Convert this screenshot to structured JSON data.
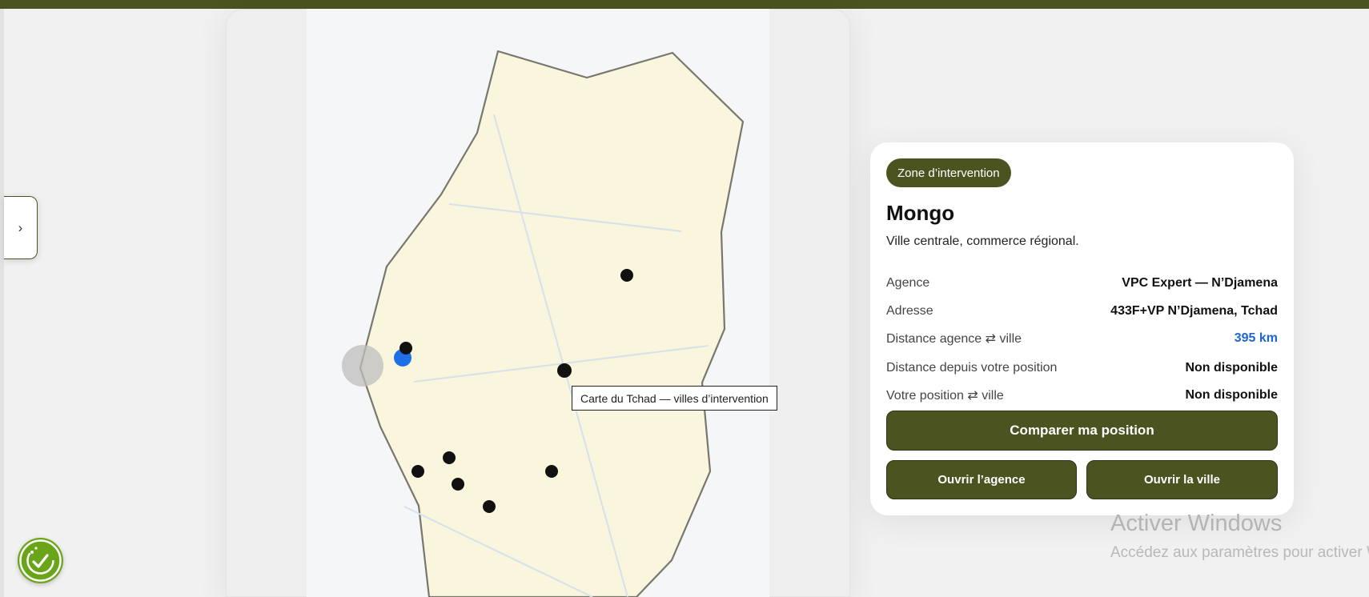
{
  "map": {
    "tooltip": "Carte du Tchad — villes d’intervention",
    "colors": {
      "fill": "#faf6de",
      "border": "#77776e",
      "road": "#d6e1ea",
      "marker": "#111111",
      "current": "#1f6fe5",
      "user_halo": "#bdbdbd"
    }
  },
  "sidebar": {
    "toggle_icon": "›"
  },
  "info": {
    "badge": "Zone d’intervention",
    "city_name": "Mongo",
    "city_description": "Ville centrale, commerce régional.",
    "rows": [
      {
        "label": "Agence",
        "value": "VPC Expert — N’Djamena"
      },
      {
        "label": "Adresse",
        "value": "433F+VP N’Djamena, Tchad"
      },
      {
        "label": "Distance agence ⇄ ville",
        "value": "395 km"
      },
      {
        "label": "Distance depuis votre position",
        "value": "Non disponible"
      },
      {
        "label": "Votre position ⇄ ville",
        "value": "Non disponible"
      }
    ],
    "buttons": {
      "compare": "Comparer ma position",
      "open_agency": "Ouvrir l’agence",
      "open_city": "Ouvrir la ville"
    }
  },
  "watermark": {
    "title": "Activer Windows",
    "subtitle": "Accédez aux paramètres pour activer Windows."
  },
  "theme": {
    "brand": "#4b5320",
    "accent_blue": "#1f66d1",
    "fab": "#6aa519"
  }
}
